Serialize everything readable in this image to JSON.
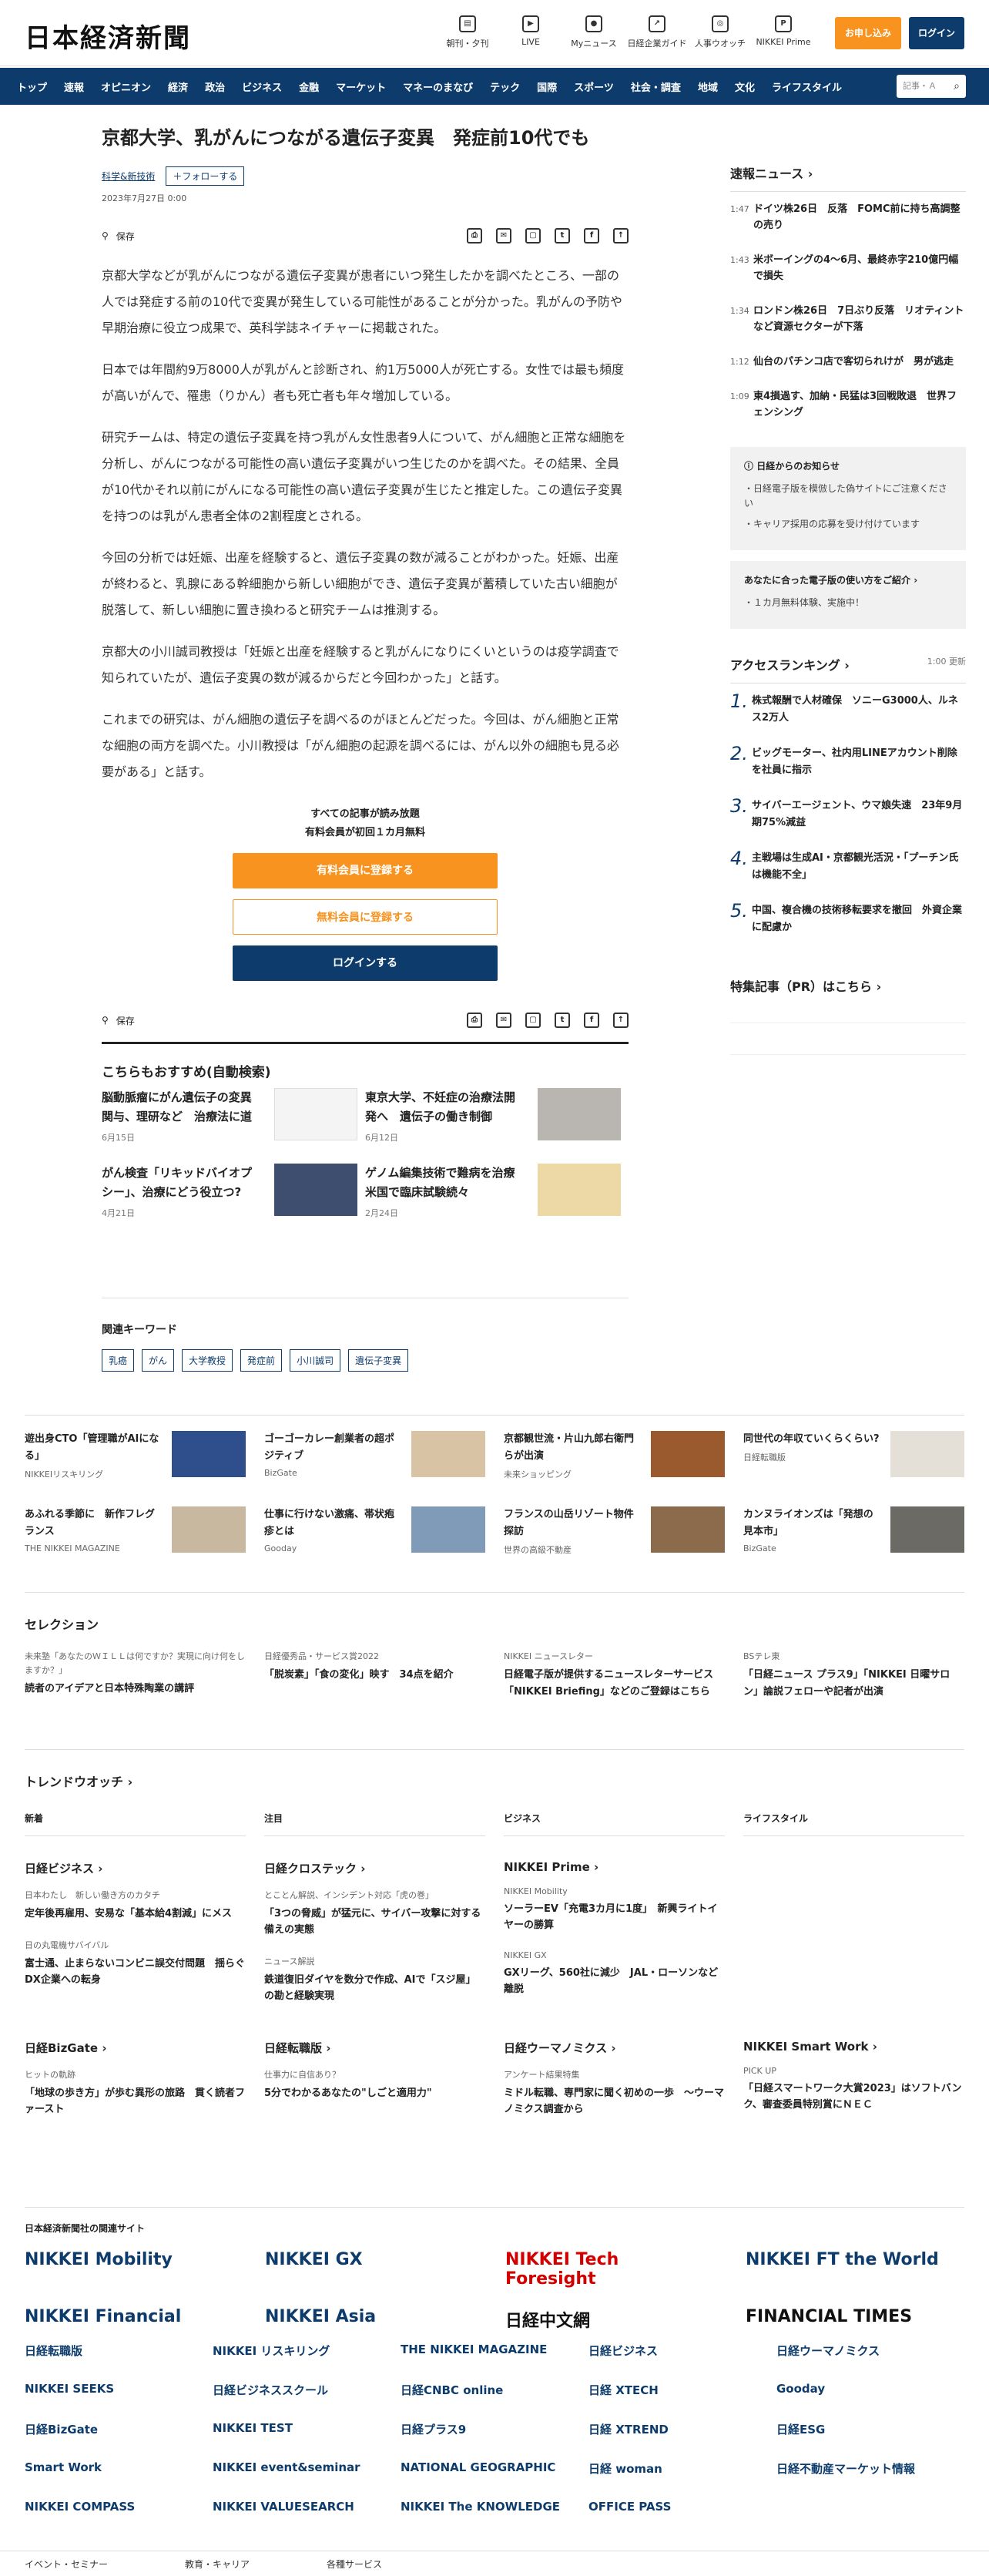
{
  "header": {
    "logo": "日本経済新聞",
    "icons": [
      {
        "label": "朝刊・夕刊",
        "icon": "newspaper-icon",
        "glyph": "▤"
      },
      {
        "label": "LIVE",
        "icon": "video-icon",
        "glyph": "▶"
      },
      {
        "label": "Myニュース",
        "icon": "user-icon",
        "glyph": "●"
      },
      {
        "label": "日経企業ガイド",
        "icon": "chart-icon",
        "glyph": "↗"
      },
      {
        "label": "人事ウオッチ",
        "icon": "search-person-icon",
        "glyph": "◎"
      },
      {
        "label": "NIKKEI Prime",
        "icon": "prime-icon",
        "glyph": "P"
      }
    ],
    "subscribe": "お申し込み",
    "login": "ログイン"
  },
  "nav": {
    "items": [
      "トップ",
      "速報",
      "オピニオン",
      "経済",
      "政治",
      "ビジネス",
      "金融",
      "マーケット",
      "マネーのまなび",
      "テック",
      "国際",
      "スポーツ",
      "社会・調査",
      "地域",
      "文化",
      "ライフスタイル"
    ],
    "search_placeholder": "記事・Ａ"
  },
  "article": {
    "title": "京都大学、乳がんにつながる遺伝子変異　発症前10代でも",
    "tag": "科学&新技術",
    "follow": "フォローする",
    "date": "2023年7月27日 0:00",
    "save": "保存",
    "paragraphs": [
      "京都大学などが乳がんにつながる遺伝子変異が患者にいつ発生したかを調べたところ、一部の人では発症する前の10代で変異が発生している可能性があることが分かった。乳がんの予防や早期治療に役立つ成果で、英科学誌ネイチャーに掲載された。",
      "日本では年間約9万8000人が乳がんと診断され、約1万5000人が死亡する。女性では最も頻度が高いがんで、罹患（りかん）者も死亡者も年々増加している。",
      "研究チームは、特定の遺伝子変異を持つ乳がん女性患者9人について、がん細胞と正常な細胞を分析し、がんにつながる可能性の高い遺伝子変異がいつ生じたのかを調べた。その結果、全員が10代かそれ以前にがんになる可能性の高い遺伝子変異が生じたと推定した。この遺伝子変異を持つのは乳がん患者全体の2割程度とされる。",
      "今回の分析では妊娠、出産を経験すると、遺伝子変異の数が減ることがわかった。妊娠、出産が終わると、乳腺にある幹細胞から新しい細胞ができ、遺伝子変異が蓄積していた古い細胞が脱落して、新しい細胞に置き換わると研究チームは推測する。",
      "京都大の小川誠司教授は「妊娠と出産を経験すると乳がんになりにくいというのは疫学調査で知られていたが、遺伝子変異の数が減るからだと今回わかった」と話す。",
      "これまでの研究は、がん細胞の遺伝子を調べるのがほとんどだった。今回は、がん細胞と正常な細胞の両方を調べた。小川教授は「がん細胞の起源を調べるには、がん以外の細胞も見る必要がある」と話す。"
    ],
    "paywall_line1": "すべての記事が読み放題",
    "paywall_line2": "有料会員が初回１カ月無料",
    "pay_btn1": "有料会員に登録する",
    "pay_btn2": "無料会員に登録する",
    "pay_btn3": "ログインする"
  },
  "recommend": {
    "title": "こちらもおすすめ(自動検索)",
    "items": [
      {
        "title": "脳動脈瘤にがん遺伝子の変異関与、理研など　治療法に道",
        "date": "6月15日"
      },
      {
        "title": "東京大学、不妊症の治療法開発へ　遺伝子の働き制御",
        "date": "6月12日"
      },
      {
        "title": "がん検査「リキッドバイオプシー」、治療にどう役立つ?",
        "date": "4月21日"
      },
      {
        "title": "ゲノム編集技術で難病を治療　米国で臨床試験続々",
        "date": "2月24日"
      }
    ]
  },
  "keywords": {
    "title": "関連キーワード",
    "items": [
      "乳癌",
      "がん",
      "大学教授",
      "発症前",
      "小川誠司",
      "遺伝子変異"
    ]
  },
  "sidebar": {
    "breaking_title": "速報ニュース",
    "breaking": [
      {
        "time": "1:47",
        "text": "ドイツ株26日　反落　FOMC前に持ち高調整の売り"
      },
      {
        "time": "1:43",
        "text": "米ボーイングの4～6月、最終赤字210億円幅で損失"
      },
      {
        "time": "1:34",
        "text": "ロンドン株26日　7日ぶり反落　リオティントなど資源セクターが下落"
      },
      {
        "time": "1:12",
        "text": "仙台のパチンコ店で客切られけが　男が逃走"
      },
      {
        "time": "1:09",
        "text": "東4損過す、加納・民猛は3回戦敗退　世界フェンシング"
      }
    ],
    "notice_title": "日経からのお知らせ",
    "notices": [
      "日経電子版を模倣した偽サイトにご注意ください",
      "キャリア採用の応募を受け付けています"
    ],
    "notice2_title": "あなたに合った電子版の使い方をご紹介",
    "notice2": "１カ月無料体験、実施中！",
    "ranking_title": "アクセスランキング",
    "ranking_update": "1:00 更新",
    "ranking": [
      "株式報酬で人材確保　ソニーG3000人、ルネス2万人",
      "ビッグモーター、社内用LINEアカウント削除を社員に指示",
      "サイバーエージェント、ウマ娘失速　23年9月期75%減益",
      "主戦場は生成AI・京都観光活況・「プーチン氏は機能不全」",
      "中国、複合機の技術移転要求を撤回　外資企業に配慮か"
    ],
    "pr_title": "特集記事（PR）はこちら"
  },
  "ads": [
    {
      "title": "遊出身CTO「管理職がAIになる」",
      "source": "NIKKEIリスキリング"
    },
    {
      "title": "ゴーゴーカレー創業者の超ポジティブ",
      "source": "BizGate"
    },
    {
      "title": "京都観世流・片山九郎右衛門らが出演",
      "source": "未来ショッピング"
    },
    {
      "title": "同世代の年収ていくらくらい?",
      "source": "日経転職版"
    },
    {
      "title": "あふれる季節に　新作フレグランス",
      "source": "THE NIKKEI MAGAZINE"
    },
    {
      "title": "仕事に行けない激痛、帯状疱疹とは",
      "source": "Gooday"
    },
    {
      "title": "フランスの山岳リゾート物件探訪",
      "source": "世界の高級不動産"
    },
    {
      "title": "カンヌライオンズは「発想の見本市」",
      "source": "BizGate"
    }
  ],
  "selection": {
    "title": "セレクション",
    "items": [
      {
        "kicker": "未来塾「あなたのＷＩＬＬは何ですか？実現に向け何をしますか？」",
        "title": "読者のアイデアと日本特殊陶業の講評"
      },
      {
        "kicker": "日経優秀品・サービス賞2022",
        "title": "「脱炭素」「食の変化」映す　34点を紹介"
      },
      {
        "kicker": "NIKKEI ニュースレター",
        "title": "日経電子版が提供するニュースレターサービス「NIKKEI Briefing」などのご登録はこちら"
      },
      {
        "kicker": "BSテレ東",
        "title": "「日経ニュース プラス9」「NIKKEI 日曜サロン」論説フェローや記者が出演"
      }
    ]
  },
  "trend": {
    "title": "トレンドウオッチ",
    "tabs": [
      "新着",
      "注目",
      "ビジネス",
      "ライフスタイル"
    ]
  },
  "media": [
    {
      "name": "日経ビジネス",
      "kicker": "日本わたし　新しい働き方のカタチ",
      "title": "定年後再雇用、安易な「基本給4割減」にメス",
      "kicker2": "日の丸電機サバイバル",
      "title2": "富士通、止まらないコンビニ誤交付問題　揺らぐDX企業への転身"
    },
    {
      "name": "日経クロステック",
      "kicker": "とことん解説、インシデント対応「虎の巻」",
      "title": "「3つの脅威」が猛元に、サイバー攻撃に対する備えの実態",
      "kicker2": "ニュース解説",
      "title2": "鉄道復旧ダイヤを数分で作成、AIで「スジ屋」の勘と経験実現"
    },
    {
      "name": "NIKKEI Prime",
      "kicker": "NIKKEI Mobility",
      "title": "ソーラーEV「充電3カ月に1度」　新興ライトイヤーの勝算",
      "kicker2": "NIKKEI GX",
      "title2": "GXリーグ、560社に減少　JAL・ローソンなど離脱"
    }
  ],
  "media2": [
    {
      "name": "日経BizGate",
      "kicker": "ヒットの軌跡",
      "title": "「地球の歩き方」が歩む異形の旅路　貫く読者ファースト"
    },
    {
      "name": "日経転職版",
      "kicker": "仕事力に自信あり？",
      "title": "5分でわかるあなたの\"しごと適用力\""
    },
    {
      "name": "日経ウーマノミクス",
      "kicker": "アンケート結果特集",
      "title": "ミドル転職、専門家に聞く初めの一歩　～ウーマノミクス調査から"
    },
    {
      "name": "NIKKEI Smart Work",
      "kicker": "PICK UP",
      "title": "「日経スマートワーク大賞2023」はソフトバンク、審査委員特別賞にＮＥＣ"
    }
  ],
  "brands_title": "日本経済新聞社の関連サイト",
  "brands": [
    "NIKKEI Mobility",
    "NIKKEI GX",
    "NIKKEI Tech Foresight",
    "NIKKEI FT the World",
    "NIKKEI Financial",
    "NIKKEI Asia",
    "日経中文網",
    "FINANCIAL TIMES"
  ],
  "small_brands": [
    "日経転職版",
    "NIKKEI リスキリング",
    "THE NIKKEI MAGAZINE",
    "日経ビジネス",
    "日経ウーマノミクス",
    "NIKKEI SEEKS",
    "日経ビジネススクール",
    "日経CNBC online",
    "日経 XTECH",
    "Gooday",
    "日経BizGate",
    "NIKKEI TEST",
    "日経プラス9",
    "日経 XTREND",
    "日経ESG",
    "Smart Work",
    "NIKKEI event&seminar",
    "NATIONAL GEOGRAPHIC",
    "日経 woman",
    "日経不動産マーケット情報",
    "NIKKEI COMPASS",
    "NIKKEI VALUESEARCH",
    "NIKKEI The KNOWLEDGE",
    "OFFICE PASS"
  ],
  "footer": [
    "イベント・セミナー",
    "教育・キャリア",
    "各種サービス"
  ],
  "colors": {
    "brand": "#0d3c6c",
    "accent": "#f7931e"
  }
}
